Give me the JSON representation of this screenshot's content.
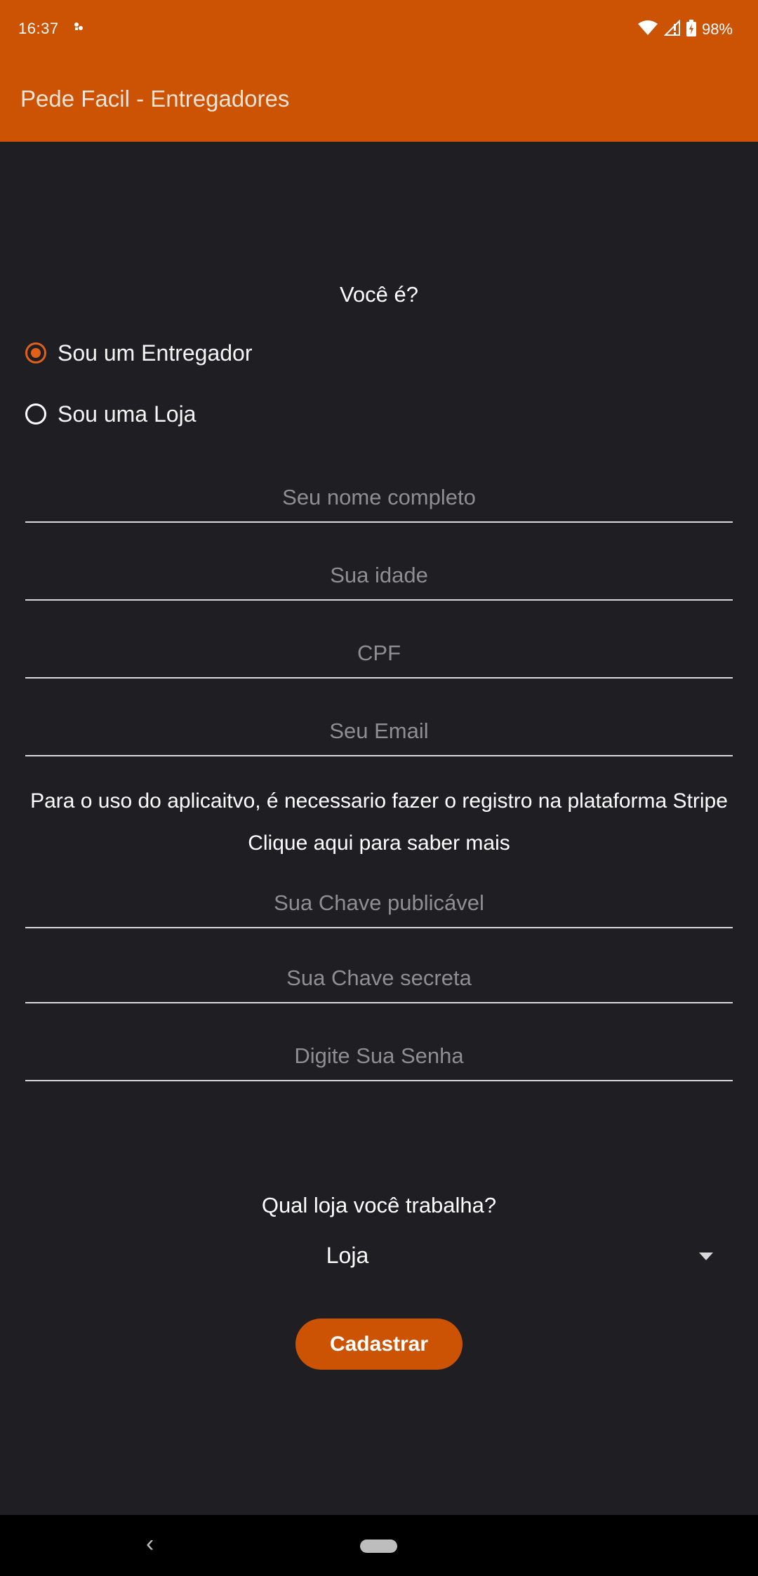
{
  "status_bar": {
    "time": "16:37",
    "battery": "98%",
    "icons": [
      "notification-icon",
      "wifi-icon",
      "signal-icon",
      "battery-icon"
    ]
  },
  "app_bar": {
    "title": "Pede Facil - Entregadores"
  },
  "form": {
    "question": "Você é?",
    "options": [
      {
        "label": "Sou um Entregador",
        "selected": true
      },
      {
        "label": "Sou uma Loja",
        "selected": false
      }
    ],
    "fields": {
      "name_placeholder": "Seu nome completo",
      "age_placeholder": "Sua idade",
      "cpf_placeholder": "CPF",
      "email_placeholder": "Seu Email",
      "publishable_key_placeholder": "Sua Chave publicável",
      "secret_key_placeholder": "Sua Chave secreta",
      "password_placeholder": "Digite Sua Senha"
    },
    "stripe_notice": "Para o uso do aplicaitvo, é necessario fazer o registro na plataforma Stripe",
    "stripe_link": "Clique aqui para saber mais",
    "store_question": "Qual loja você trabalha?",
    "store_selected": "Loja",
    "submit_label": "Cadastrar"
  },
  "colors": {
    "accent": "#cc5204",
    "background": "#1f1f23",
    "radio_checked": "#e0601a"
  }
}
